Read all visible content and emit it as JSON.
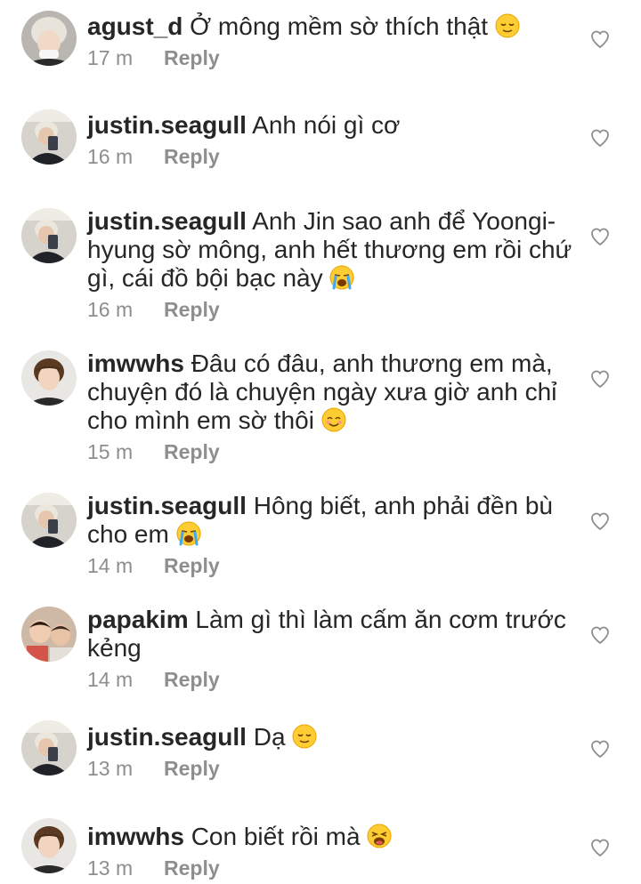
{
  "comments": [
    {
      "username": "agust_d",
      "text": "Ở mông mềm sờ thích thật",
      "emoji": "relieved",
      "time": "17 m",
      "reply": "Reply",
      "avatar": "blond"
    },
    {
      "username": "justin.seagull",
      "text": "Anh nói gì cơ",
      "emoji": "",
      "time": "16 m",
      "reply": "Reply",
      "avatar": "mirror"
    },
    {
      "username": "justin.seagull",
      "text": "Anh Jin sao anh để Yoongi-hyung sờ mông, anh hết thương em rồi chứ gì, cái đồ bội bạc này",
      "emoji": "crying",
      "time": "16 m",
      "reply": "Reply",
      "avatar": "mirror"
    },
    {
      "username": "imwwhs",
      "text": "Đâu có đâu, anh thương em mà, chuyện đó là chuyện ngày xưa giờ anh chỉ cho mình em sờ thôi",
      "emoji": "smiling",
      "time": "15 m",
      "reply": "Reply",
      "avatar": "brown"
    },
    {
      "username": "justin.seagull",
      "text": "Hông biết, anh phải đền bù cho em",
      "emoji": "crying",
      "time": "14 m",
      "reply": "Reply",
      "avatar": "mirror"
    },
    {
      "username": "papakim",
      "text": "Làm gì thì làm cấm ăn cơm trước kẻng",
      "emoji": "",
      "time": "14 m",
      "reply": "Reply",
      "avatar": "kids"
    },
    {
      "username": "justin.seagull",
      "text": "Dạ",
      "emoji": "relieved",
      "time": "13 m",
      "reply": "Reply",
      "avatar": "mirror"
    },
    {
      "username": "imwwhs",
      "text": "Con biết rồi mà",
      "emoji": "weary",
      "time": "13 m",
      "reply": "Reply",
      "avatar": "brown"
    }
  ]
}
